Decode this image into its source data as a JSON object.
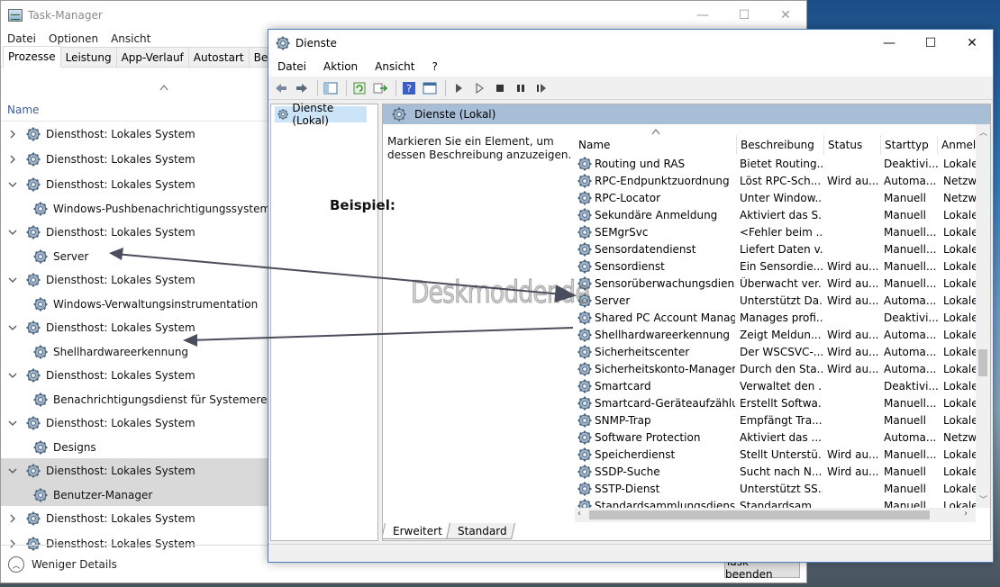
{
  "taskmanager": {
    "title": "Task-Manager",
    "window_controls": [
      "—",
      "☐",
      "✕"
    ],
    "menu": [
      "Datei",
      "Optionen",
      "Ansicht"
    ],
    "tabs": [
      "Prozesse",
      "Leistung",
      "App-Verlauf",
      "Autostart",
      "Benutzer"
    ],
    "column_name": "Name",
    "rows": [
      {
        "label": "Diensthost: Lokales System",
        "expanded": false,
        "child": false
      },
      {
        "label": "Diensthost: Lokales System",
        "expanded": false,
        "child": false
      },
      {
        "label": "Diensthost: Lokales System",
        "expanded": true,
        "child": false
      },
      {
        "label": "Windows-Pushbenachrichtigungssystemdienst",
        "child": true
      },
      {
        "label": "Diensthost: Lokales System",
        "expanded": true,
        "child": false
      },
      {
        "label": "Server",
        "child": true
      },
      {
        "label": "Diensthost: Lokales System",
        "expanded": true,
        "child": false
      },
      {
        "label": "Windows-Verwaltungsinstrumentation",
        "child": true
      },
      {
        "label": "Diensthost: Lokales System",
        "expanded": true,
        "child": false
      },
      {
        "label": "Shellhardwareerkennung",
        "child": true
      },
      {
        "label": "Diensthost: Lokales System",
        "expanded": true,
        "child": false
      },
      {
        "label": "Benachrichtigungsdienst für Systemereignisse",
        "child": true
      },
      {
        "label": "Diensthost: Lokales System",
        "expanded": true,
        "child": false
      },
      {
        "label": "Designs",
        "child": true
      },
      {
        "label": "Diensthost: Lokales System",
        "expanded": true,
        "child": false,
        "selected": true
      },
      {
        "label": "Benutzer-Manager",
        "child": true,
        "selected": true
      },
      {
        "label": "Diensthost: Lokales System",
        "expanded": false,
        "child": false
      },
      {
        "label": "Diensthost: Lokales System",
        "expanded": false,
        "child": false
      }
    ],
    "footer": {
      "less_details": "Weniger Details",
      "end_task": "Task beenden"
    }
  },
  "services": {
    "title": "Dienste",
    "window_controls": [
      "—",
      "☐",
      "✕"
    ],
    "menu": [
      "Datei",
      "Aktion",
      "Ansicht",
      "?"
    ],
    "tree_node": "Dienste (Lokal)",
    "content_header": "Dienste (Lokal)",
    "description_hint": "Markieren Sie ein Element, um dessen Beschreibung anzuzeigen.",
    "columns": [
      "Name",
      "Beschreibung",
      "Status",
      "Starttyp",
      "Anmel"
    ],
    "rows": [
      [
        "Routing und RAS",
        "Bietet Routing...",
        "",
        "Deaktivi...",
        "Lokale"
      ],
      [
        "RPC-Endpunktzuordnung",
        "Löst RPC-Sch...",
        "Wird au...",
        "Automa...",
        "Netzw"
      ],
      [
        "RPC-Locator",
        "Unter Window...",
        "",
        "Manuell",
        "Netzw"
      ],
      [
        "Sekundäre Anmeldung",
        "Aktiviert das S...",
        "",
        "Manuell",
        "Lokale"
      ],
      [
        "SEMgrSvc",
        "<Fehler beim ...",
        "",
        "Manuell...",
        "Lokale"
      ],
      [
        "Sensordatendienst",
        "Liefert Daten v...",
        "",
        "Manuell...",
        "Lokale"
      ],
      [
        "Sensordienst",
        "Ein Sensordie...",
        "Wird au...",
        "Manuell...",
        "Lokale"
      ],
      [
        "Sensorüberwachungsdienst",
        "Überwacht ver...",
        "Wird au...",
        "Manuell...",
        "Lokale"
      ],
      [
        "Server",
        "Unterstützt Da...",
        "Wird au...",
        "Automa...",
        "Lokale"
      ],
      [
        "Shared PC Account Manager",
        "Manages profi...",
        "",
        "Deaktivi...",
        "Lokale"
      ],
      [
        "Shellhardwareerkennung",
        "Zeigt Meldun...",
        "Wird au...",
        "Automa...",
        "Lokale"
      ],
      [
        "Sicherheitscenter",
        "Der WSCSVC-...",
        "Wird au...",
        "Automa...",
        "Lokale"
      ],
      [
        "Sicherheitskonto-Manager",
        "Durch den Sta...",
        "Wird au...",
        "Automa...",
        "Lokale"
      ],
      [
        "Smartcard",
        "Verwaltet den ...",
        "",
        "Deaktivi...",
        "Lokale"
      ],
      [
        "Smartcard-Geräteaufzählun...",
        "Erstellt Softwa...",
        "",
        "Manuell...",
        "Lokale"
      ],
      [
        "SNMP-Trap",
        "Empfängt Tra...",
        "",
        "Manuell",
        "Lokale"
      ],
      [
        "Software Protection",
        "Aktiviert das ...",
        "",
        "Automa...",
        "Netzw"
      ],
      [
        "Speicherdienst",
        "Stellt Unterstü...",
        "Wird au...",
        "Manuell...",
        "Lokale"
      ],
      [
        "SSDP-Suche",
        "Sucht nach N...",
        "Wird au...",
        "Manuell",
        "Lokale"
      ],
      [
        "SSTP-Dienst",
        "Unterstützt SS...",
        "",
        "Manuell",
        "Lokale"
      ],
      [
        "Standardsammlungsdienst ...",
        "Standardsam...",
        "",
        "Manuell",
        "Lokale"
      ]
    ],
    "bottom_tabs": [
      "Erweitert",
      "Standard"
    ]
  },
  "annotation": {
    "label": "Beispiel:",
    "watermark": "Deskmodder.de"
  },
  "colors": {
    "selection": "#d9d9d9",
    "header_band": "#a7bed6",
    "tree_selected": "#cce4f7",
    "accent_border": "#4b7ec2"
  }
}
